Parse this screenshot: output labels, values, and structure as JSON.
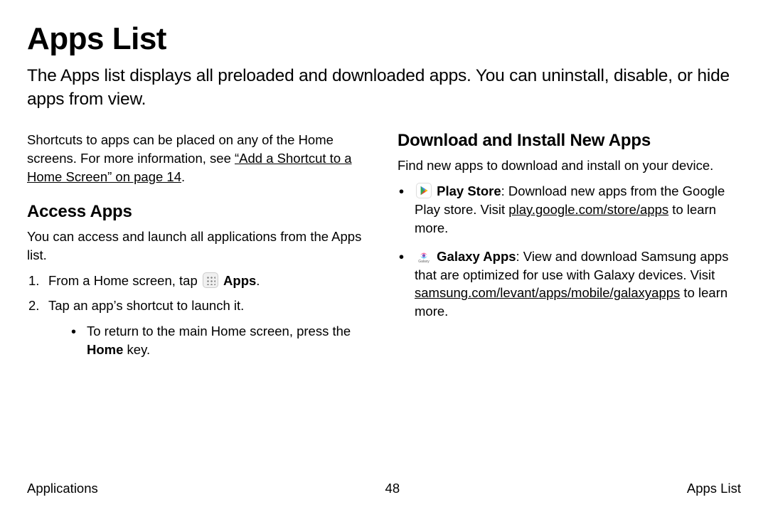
{
  "title": "Apps List",
  "intro": "The Apps list displays all preloaded and downloaded apps. You can uninstall, disable, or hide apps from view.",
  "left": {
    "shortcut_prefix": "Shortcuts to apps can be placed on any of the Home screens. For more information, see ",
    "shortcut_link": "“Add a Shortcut to a Home Screen” on page 14",
    "shortcut_suffix": ".",
    "access_head": "Access Apps",
    "access_body": "You can access and launch all applications from the Apps list.",
    "step1_prefix": "From a Home screen, tap ",
    "step1_icon_name": "apps-grid-icon",
    "step1_suffix_bold": "Apps",
    "step1_suffix_end": ".",
    "step2": "Tap an app’s shortcut to launch it.",
    "step2_sub_prefix": "To return to the main Home screen, press the ",
    "step2_sub_bold": "Home",
    "step2_sub_suffix": " key."
  },
  "right": {
    "download_head": "Download and Install New Apps",
    "download_body": "Find new apps to download and install on your device.",
    "item1_bold": "Play Store",
    "item1_text1": ": Download new apps from the Google Play store. Visit ",
    "item1_link": "play.google.com/store/apps",
    "item1_text2": " to learn more.",
    "item2_bold": "Galaxy Apps",
    "item2_text1": ": View and download Samsung apps that are optimized for use with Galaxy devices. Visit ",
    "item2_link": "samsung.com/levant/apps/mobile/galaxyapps",
    "item2_text2": " to learn more."
  },
  "footer": {
    "left": "Applications",
    "center": "48",
    "right": "Apps List"
  }
}
